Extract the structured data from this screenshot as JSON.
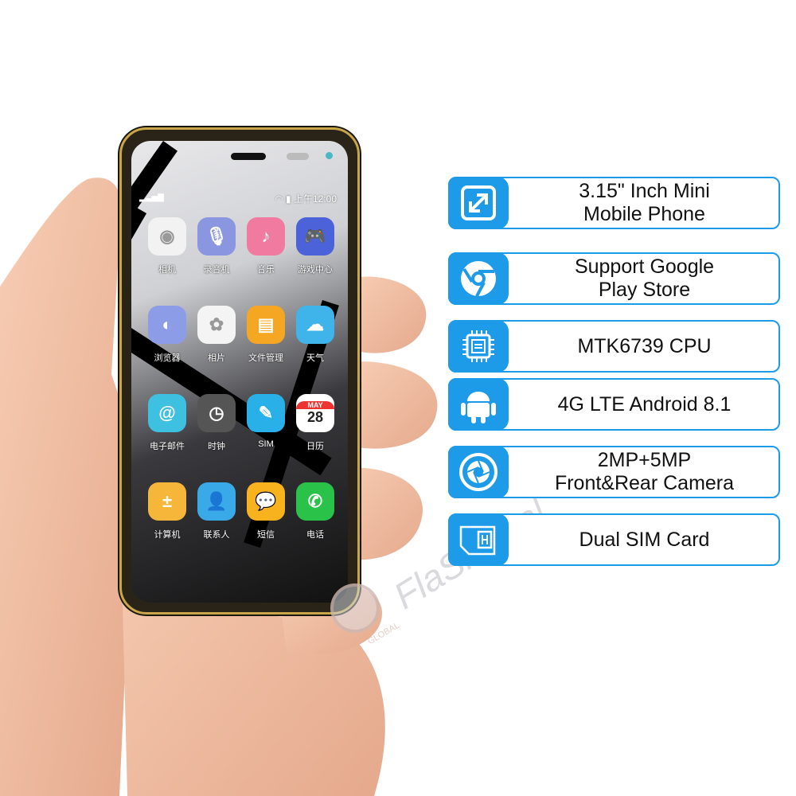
{
  "phone": {
    "status_time": "上午12:00",
    "apps": [
      {
        "label": "相机",
        "icon": "camera-icon",
        "color": "#f2f2f2"
      },
      {
        "label": "录音机",
        "icon": "microphone-icon",
        "color": "#8a97e0"
      },
      {
        "label": "音乐",
        "icon": "music-note-icon",
        "color": "#f07aa0"
      },
      {
        "label": "游戏中心",
        "icon": "gamepad-icon",
        "color": "#4c62d8"
      },
      {
        "label": "浏览器",
        "icon": "globe-icon",
        "color": "#8d9ce6"
      },
      {
        "label": "相片",
        "icon": "photos-flower-icon",
        "color": "#f4f4f4"
      },
      {
        "label": "文件管理",
        "icon": "folder-icon",
        "color": "#f5a623"
      },
      {
        "label": "天气",
        "icon": "weather-icon",
        "color": "#3fb4ea"
      },
      {
        "label": "电子邮件",
        "icon": "email-at-icon",
        "color": "#3ec1e0"
      },
      {
        "label": "时钟",
        "icon": "clock-icon",
        "color": "#555555"
      },
      {
        "label": "SIM",
        "icon": "sim-tools-icon",
        "color": "#2ab0e8"
      },
      {
        "label": "日历",
        "icon": "calendar-icon",
        "color": "#ffffff",
        "month": "MAY",
        "day": "28"
      },
      {
        "label": "计算机",
        "icon": "calculator-icon",
        "color": "#f5b63a"
      },
      {
        "label": "联系人",
        "icon": "contacts-icon",
        "color": "#3aa9e8"
      },
      {
        "label": "短信",
        "icon": "message-icon",
        "color": "#f7b21e"
      },
      {
        "label": "电话",
        "icon": "phone-icon",
        "color": "#2bc24a"
      }
    ]
  },
  "features": [
    {
      "icon": "resize-arrows-icon",
      "lines": [
        "3.15\" Inch Mini",
        "Mobile Phone"
      ]
    },
    {
      "icon": "chrome-icon",
      "lines": [
        "Support Google",
        "Play Store"
      ]
    },
    {
      "icon": "cpu-chip-icon",
      "lines": [
        "MTK6739 CPU"
      ]
    },
    {
      "icon": "android-icon",
      "lines": [
        "4G LTE Android 8.1"
      ]
    },
    {
      "icon": "camera-shutter-icon",
      "lines": [
        "2MP+5MP",
        "Front&Rear Camera"
      ]
    },
    {
      "icon": "sim-card-icon",
      "lines": [
        "Dual SIM Card"
      ]
    }
  ],
  "accent_color": "#1e9be8",
  "watermark": {
    "brand": "FlashDeal",
    "sub": "GLOBAL"
  }
}
